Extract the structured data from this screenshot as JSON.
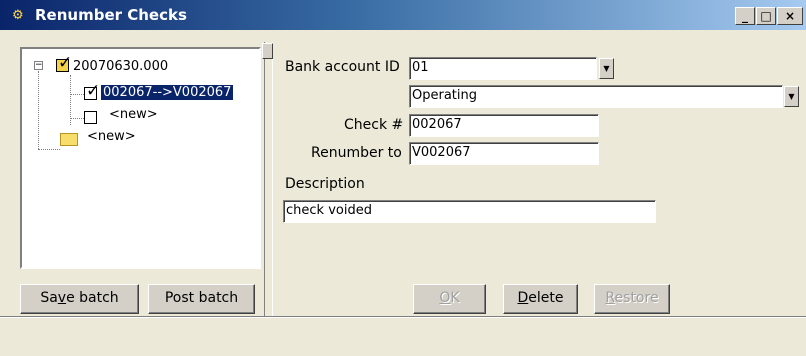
{
  "window": {
    "title": "Renumber Checks",
    "controls": {
      "minimize": "_",
      "maximize": "□",
      "close": "×"
    }
  },
  "tree": {
    "root_label": "20070630.000",
    "check_item_label": "002067-->V002067",
    "new_check_label": "<new>",
    "new_folder_label": "<new>"
  },
  "buttons": {
    "save_batch": {
      "before": "Sa",
      "accel": "v",
      "after": "e batch"
    },
    "post_batch": "Post batch",
    "ok": {
      "accel": "O",
      "after": "K",
      "disabled": true
    },
    "delete": {
      "accel": "D",
      "after": "elete",
      "disabled": false
    },
    "restore": {
      "accel": "R",
      "after": "estore",
      "disabled": true
    }
  },
  "form": {
    "bank_account_id_label": "Bank account ID",
    "bank_account_id_value": "01",
    "bank_account_name": "Operating",
    "check_number_label": "Check #",
    "check_number_value": "002067",
    "renumber_to_label": "Renumber to",
    "renumber_to_value": "V002067",
    "description_label": "Description",
    "description_value": "check voided"
  },
  "icons": {
    "app": "app-icon",
    "dropdown": "chevron-down-icon"
  }
}
